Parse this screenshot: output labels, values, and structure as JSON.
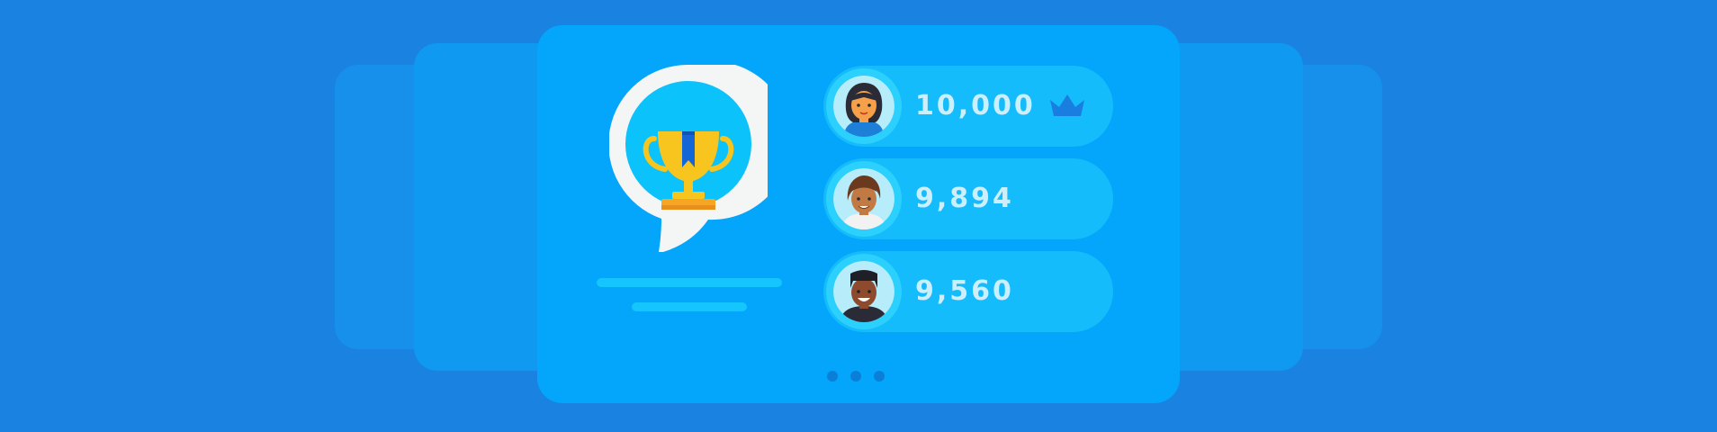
{
  "leaderboard": {
    "entries": [
      {
        "score": "10,000",
        "rank_icon": "crown-icon"
      },
      {
        "score": "9,894"
      },
      {
        "score": "9,560"
      }
    ]
  },
  "carousel": {
    "pages": 3,
    "active": 1
  },
  "colors": {
    "background": "#1a82e0",
    "card": "#03a6fb",
    "row": "#14bcfc",
    "score_text": "#cdeefb",
    "trophy": "#f7c51e",
    "ribbon": "#1466d6",
    "crown": "#1a7de0"
  },
  "icons": [
    "skill-badge-icon",
    "trophy-icon",
    "crown-icon"
  ]
}
